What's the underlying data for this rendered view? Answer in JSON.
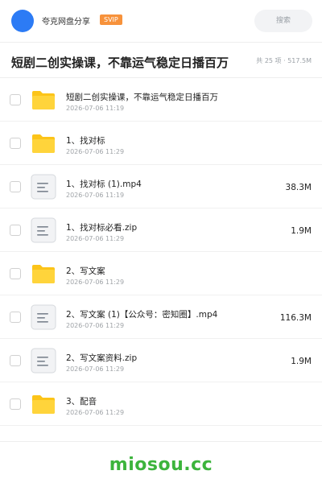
{
  "header": {
    "share_title": "夸克网盘分享",
    "badge": "SVIP",
    "search_label": "搜索"
  },
  "folder": {
    "title": "短剧二创实操课，不靠运气稳定日播百万",
    "meta": "共 25 项 · 517.5M"
  },
  "colors": {
    "accent": "#2c7bf5",
    "badge": "#f7923b",
    "folder_icon": "#fcc419",
    "watermark": "#3cb43c"
  },
  "files": [
    {
      "name": "短剧二创实操课，不靠运气稳定日播百万",
      "time": "2026-07-06 11:19",
      "size": "",
      "icon": "folder-icon"
    },
    {
      "name": "1、找对标",
      "time": "2026-07-06 11:29",
      "size": "",
      "icon": "folder-icon"
    },
    {
      "name": "1、找对标 (1).mp4",
      "time": "2026-07-06 11:19",
      "size": "38.3M",
      "icon": "file-doc-icon"
    },
    {
      "name": "1、找对标必看.zip",
      "time": "2026-07-06 11:29",
      "size": "1.9M",
      "icon": "file-doc-icon"
    },
    {
      "name": "2、写文案",
      "time": "2026-07-06 11:29",
      "size": "",
      "icon": "folder-icon"
    },
    {
      "name": "2、写文案 (1)【公众号：密知圈】.mp4",
      "time": "2026-07-06 11:29",
      "size": "116.3M",
      "icon": "file-doc-icon"
    },
    {
      "name": "2、写文案资料.zip",
      "time": "2026-07-06 11:29",
      "size": "1.9M",
      "icon": "file-doc-icon"
    },
    {
      "name": "3、配音",
      "time": "2026-07-06 11:29",
      "size": "",
      "icon": "folder-icon"
    }
  ],
  "footer": {
    "watermark": "miosou.cc"
  }
}
